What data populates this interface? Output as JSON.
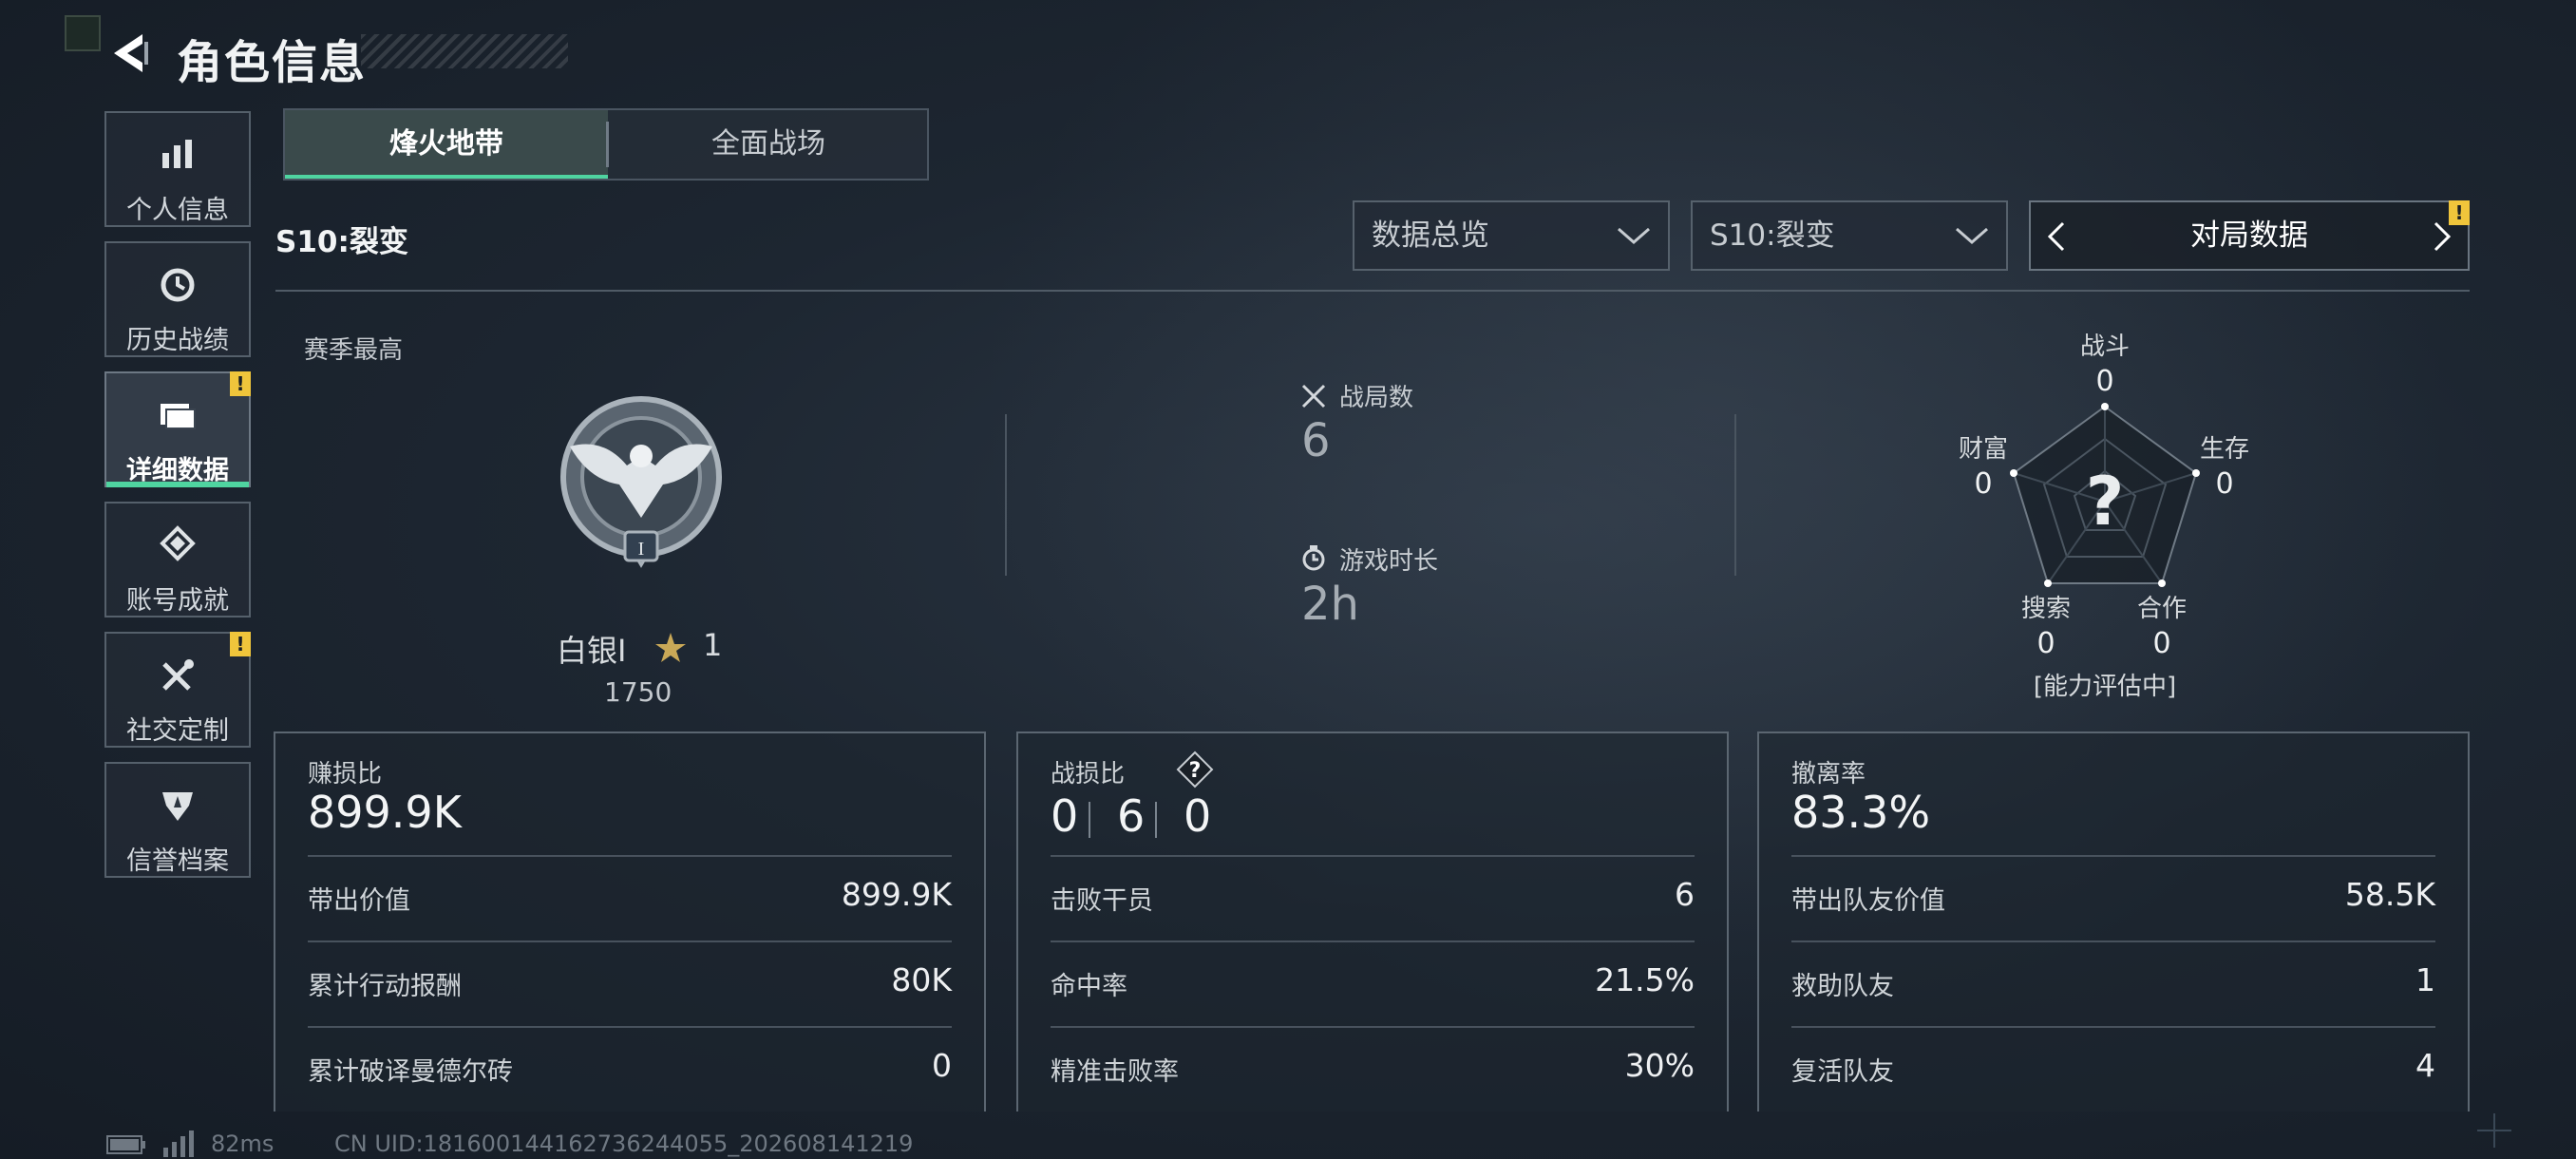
{
  "header": {
    "title": "角色信息"
  },
  "sidebar": {
    "items": [
      {
        "label": "个人信息",
        "icon": "bar-chart-icon",
        "active": false,
        "badge": ""
      },
      {
        "label": "历史战绩",
        "icon": "clock-icon",
        "active": false,
        "badge": ""
      },
      {
        "label": "详细数据",
        "icon": "folder-icon",
        "active": true,
        "badge": "!"
      },
      {
        "label": "账号成就",
        "icon": "achievement-icon",
        "active": false,
        "badge": ""
      },
      {
        "label": "社交定制",
        "icon": "tools-icon",
        "active": false,
        "badge": "!"
      },
      {
        "label": "信誉档案",
        "icon": "credit-shield-icon",
        "active": false,
        "badge": ""
      }
    ]
  },
  "mode_tabs": [
    "烽火地带",
    "全面战场"
  ],
  "season_label": "S10:裂变",
  "filters": {
    "overview": "数据总览",
    "season": "S10:裂变",
    "switcher": "对局数据",
    "switcher_badge": "!"
  },
  "rank": {
    "section_label": "赛季最高",
    "name": "白银Ⅰ",
    "stars": "1",
    "score": "1750",
    "emblem_numeral": "I"
  },
  "match_stats": {
    "matches_label": "战局数",
    "matches_value": "6",
    "time_label": "游戏时长",
    "time_value": "2h"
  },
  "radar": {
    "center": "?",
    "combat_label": "战斗",
    "combat_value": "0",
    "survival_label": "生存",
    "survival_value": "0",
    "coop_label": "合作",
    "coop_value": "0",
    "search_label": "搜索",
    "search_value": "0",
    "wealth_label": "财富",
    "wealth_value": "0",
    "status": "[能力评估中]"
  },
  "cards": {
    "profit": {
      "title": "赚损比",
      "value": "899.9K",
      "rows": [
        {
          "k": "带出价值",
          "v": "899.9K"
        },
        {
          "k": "累计行动报酬",
          "v": "80K"
        },
        {
          "k": "累计破译曼德尔砖",
          "v": "0"
        }
      ]
    },
    "combat": {
      "title": "战损比",
      "help": "?",
      "kda": [
        "0",
        "6",
        "0"
      ],
      "rows": [
        {
          "k": "击败干员",
          "v": "6"
        },
        {
          "k": "命中率",
          "v": "21.5%"
        },
        {
          "k": "精准击败率",
          "v": "30%"
        }
      ]
    },
    "extract": {
      "title": "撤离率",
      "value": "83.3%",
      "rows": [
        {
          "k": "带出队友价值",
          "v": "58.5K"
        },
        {
          "k": "救助队友",
          "v": "1"
        },
        {
          "k": "复活队友",
          "v": "4"
        }
      ]
    }
  },
  "footer": {
    "ping": "82ms",
    "uid": "CN UID:18160014416273624405​5_202608141219"
  },
  "colors": {
    "accent": "#4fd4a0",
    "badge": "#f0c53b"
  }
}
